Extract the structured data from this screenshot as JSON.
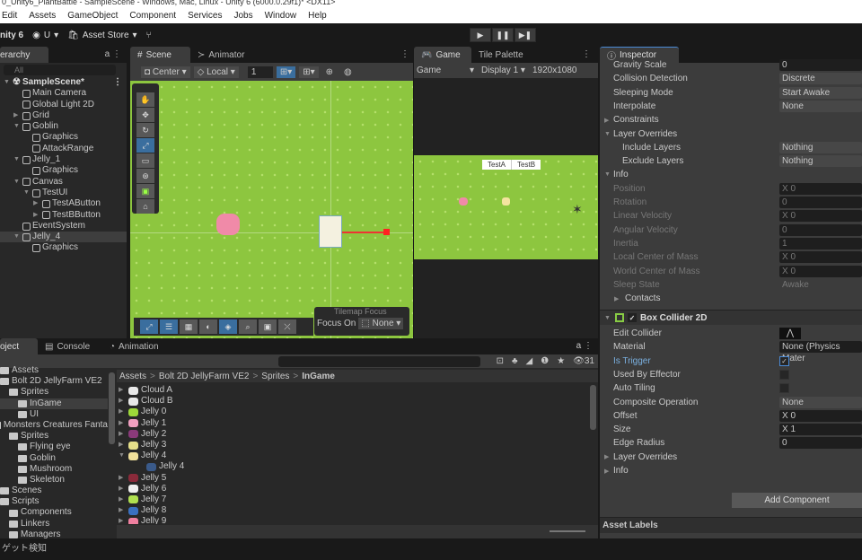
{
  "window_title": "0_Unity6_PlantBattle - SampleScene - Windows, Mac, Linux - Unity 6 (6000.0.29f1)* <DX11>",
  "menu": [
    "Edit",
    "Assets",
    "GameObject",
    "Component",
    "Services",
    "Jobs",
    "Window",
    "Help"
  ],
  "toolbar": {
    "brand": "nity 6",
    "account": "U",
    "asset_store": "Asset Store",
    "play": "▶",
    "pause": "❚❚",
    "step": "▶❚"
  },
  "hierarchy": {
    "tab": "erarchy",
    "search_placeholder": "All",
    "scene": "SampleScene*",
    "items": [
      {
        "label": "Main Camera",
        "depth": 1,
        "arrow": ""
      },
      {
        "label": "Global Light 2D",
        "depth": 1,
        "arrow": ""
      },
      {
        "label": "Grid",
        "depth": 1,
        "arrow": "▶"
      },
      {
        "label": "Goblin",
        "depth": 1,
        "arrow": "▼"
      },
      {
        "label": "Graphics",
        "depth": 2,
        "arrow": ""
      },
      {
        "label": "AttackRange",
        "depth": 2,
        "arrow": ""
      },
      {
        "label": "Jelly_1",
        "depth": 1,
        "arrow": "▼"
      },
      {
        "label": "Graphics",
        "depth": 2,
        "arrow": ""
      },
      {
        "label": "Canvas",
        "depth": 1,
        "arrow": "▼"
      },
      {
        "label": "TestUI",
        "depth": 2,
        "arrow": "▼"
      },
      {
        "label": "TestAButton",
        "depth": 3,
        "arrow": "▶"
      },
      {
        "label": "TestBButton",
        "depth": 3,
        "arrow": "▶"
      },
      {
        "label": "EventSystem",
        "depth": 1,
        "arrow": ""
      },
      {
        "label": "Jelly_4",
        "depth": 1,
        "arrow": "▼",
        "selected": true
      },
      {
        "label": "Graphics",
        "depth": 2,
        "arrow": ""
      }
    ]
  },
  "scene": {
    "tabs": [
      "Scene",
      "Animator"
    ],
    "pivot": "Center",
    "space": "Local",
    "snap": "1",
    "tilemap_focus": {
      "title": "Tilemap Focus",
      "label": "Focus On",
      "value": "None"
    }
  },
  "game": {
    "tabs": [
      "Game",
      "Tile Palette"
    ],
    "mode": "Game",
    "display": "Display 1",
    "resolution": "1920x1080",
    "buttons": [
      "TestA",
      "TestB"
    ]
  },
  "inspector": {
    "tab": "Inspector",
    "rows_top": [
      {
        "label": "Gravity Scale",
        "value": "0",
        "kind": "field"
      },
      {
        "label": "Collision Detection",
        "value": "Discrete",
        "kind": "drop"
      },
      {
        "label": "Sleeping Mode",
        "value": "Start Awake",
        "kind": "drop"
      },
      {
        "label": "Interpolate",
        "value": "None",
        "kind": "drop"
      },
      {
        "label": "Constraints",
        "value": "",
        "kind": "fold"
      },
      {
        "label": "Layer Overrides",
        "value": "",
        "kind": "foldopen"
      },
      {
        "label": "Include Layers",
        "value": "Nothing",
        "kind": "drop",
        "indent": true
      },
      {
        "label": "Exclude Layers",
        "value": "Nothing",
        "kind": "drop",
        "indent": true
      },
      {
        "label": "Info",
        "value": "",
        "kind": "foldopen"
      },
      {
        "label": "Position",
        "value": "X  0",
        "kind": "dim"
      },
      {
        "label": "Rotation",
        "value": "0",
        "kind": "dim"
      },
      {
        "label": "Linear Velocity",
        "value": "X  0",
        "kind": "dim"
      },
      {
        "label": "Angular Velocity",
        "value": "0",
        "kind": "dim"
      },
      {
        "label": "Inertia",
        "value": "1",
        "kind": "dim"
      },
      {
        "label": "Local Center of Mass",
        "value": "X  0",
        "kind": "dim"
      },
      {
        "label": "World Center of Mass",
        "value": "X  0",
        "kind": "dim"
      },
      {
        "label": "Sleep State",
        "value": "Awake",
        "kind": "dimplain"
      },
      {
        "label": "Contacts",
        "value": "",
        "kind": "fold",
        "indent": true
      }
    ],
    "component": "Box Collider 2D",
    "rows_bottom": [
      {
        "label": "Edit Collider",
        "value": "",
        "kind": "editbtn"
      },
      {
        "label": "Material",
        "value": "None (Physics Mater",
        "kind": "field"
      },
      {
        "label": "Is Trigger",
        "value": "✓",
        "kind": "check",
        "highlight": true
      },
      {
        "label": "Used By Effector",
        "value": "",
        "kind": "check"
      },
      {
        "label": "Auto Tiling",
        "value": "",
        "kind": "check"
      },
      {
        "label": "Composite Operation",
        "value": "None",
        "kind": "drop"
      },
      {
        "label": "Offset",
        "value": "X  0",
        "kind": "field"
      },
      {
        "label": "Size",
        "value": "X  1",
        "kind": "field"
      },
      {
        "label": "Edge Radius",
        "value": "0",
        "kind": "field"
      },
      {
        "label": "Layer Overrides",
        "value": "",
        "kind": "fold"
      },
      {
        "label": "Info",
        "value": "",
        "kind": "fold"
      }
    ],
    "add_component": "Add Component",
    "asset_labels": "Asset Labels"
  },
  "bottom": {
    "tabs": [
      "oject",
      "Console",
      "Animation"
    ],
    "count": "31",
    "breadcrumb": [
      "Assets",
      "Bolt 2D JellyFarm VE2",
      "Sprites",
      "InGame"
    ],
    "tree": [
      {
        "label": "Assets",
        "depth": 0
      },
      {
        "label": "Bolt 2D JellyFarm VE2",
        "depth": 0
      },
      {
        "label": "Sprites",
        "depth": 1
      },
      {
        "label": "InGame",
        "depth": 2,
        "selected": true
      },
      {
        "label": "UI",
        "depth": 2
      },
      {
        "label": "Monsters Creatures Fanta",
        "depth": 0
      },
      {
        "label": "Sprites",
        "depth": 1
      },
      {
        "label": "Flying eye",
        "depth": 2
      },
      {
        "label": "Goblin",
        "depth": 2
      },
      {
        "label": "Mushroom",
        "depth": 2
      },
      {
        "label": "Skeleton",
        "depth": 2
      },
      {
        "label": "Scenes",
        "depth": 0
      },
      {
        "label": "Scripts",
        "depth": 0
      },
      {
        "label": "Components",
        "depth": 1
      },
      {
        "label": "Linkers",
        "depth": 1
      },
      {
        "label": "Managers",
        "depth": 1
      }
    ],
    "assets": [
      {
        "label": "Cloud A",
        "color": "#e8e8e8",
        "arrow": "▶"
      },
      {
        "label": "Cloud B",
        "color": "#e8e8e8",
        "arrow": "▶"
      },
      {
        "label": "Jelly 0",
        "color": "#9ed83a",
        "arrow": "▶"
      },
      {
        "label": "Jelly 1",
        "color": "#f0a0c0",
        "arrow": "▶"
      },
      {
        "label": "Jelly 2",
        "color": "#8a3a7a",
        "arrow": "▶"
      },
      {
        "label": "Jelly 3",
        "color": "#e6e08a",
        "arrow": "▶"
      },
      {
        "label": "Jelly 4",
        "color": "#f0e09a",
        "arrow": "▼"
      },
      {
        "label": "Jelly 4",
        "color": "#3a5a8a",
        "arrow": "",
        "child": true
      },
      {
        "label": "Jelly 5",
        "color": "#8a2a3a",
        "arrow": "▶"
      },
      {
        "label": "Jelly 6",
        "color": "#f0f0f0",
        "arrow": "▶"
      },
      {
        "label": "Jelly 7",
        "color": "#b0e050",
        "arrow": "▶"
      },
      {
        "label": "Jelly 8",
        "color": "#3a70c0",
        "arrow": "▶"
      },
      {
        "label": "Jelly 9",
        "color": "#f080a0",
        "arrow": "▶"
      }
    ]
  },
  "status": "ゲット検知",
  "colors": {
    "accent": "#3a6e9e",
    "grass": "#8dc63f",
    "panel": "#282828"
  }
}
